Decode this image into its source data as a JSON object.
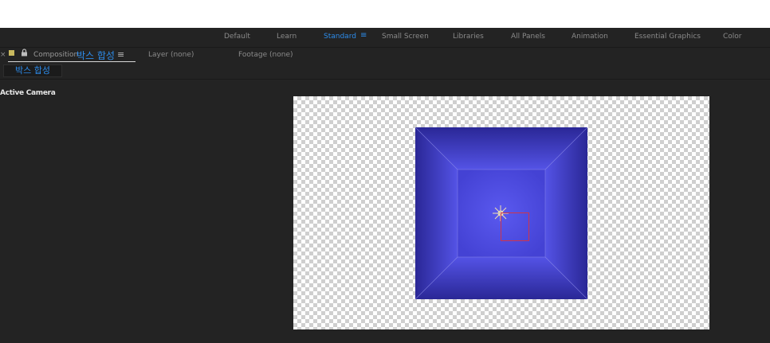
{
  "workspaces": [
    {
      "label": "Default"
    },
    {
      "label": "Learn"
    },
    {
      "label": "Standard",
      "active": true
    },
    {
      "label": "Small Screen"
    },
    {
      "label": "Libraries"
    },
    {
      "label": "All Panels"
    },
    {
      "label": "Animation"
    },
    {
      "label": "Essential Graphics"
    },
    {
      "label": "Color"
    }
  ],
  "workspace_menu_icon": "hamburger-icon",
  "panel": {
    "close_icon": "×",
    "comp_prefix": "Composition",
    "comp_name": "박스 합성",
    "menu_icon": "≡",
    "layer_tab": "Layer  (none)",
    "footage_tab": "Footage  (none)"
  },
  "breadcrumb": "박스 합성",
  "viewer": {
    "camera_label": "Active Camera"
  },
  "colors": {
    "accent": "#2d8ceb",
    "panel_bg": "#232323",
    "box": "#4a48d8",
    "selection": "#d0354a"
  }
}
